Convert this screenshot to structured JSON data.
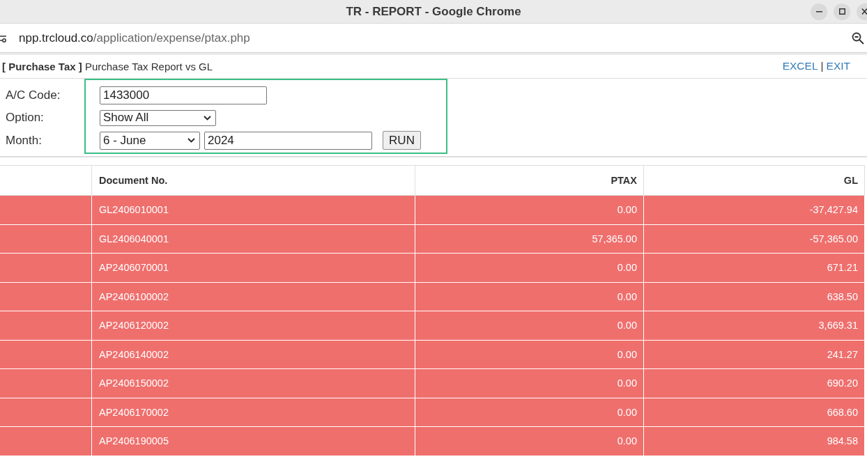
{
  "window": {
    "title": "TR - REPORT - Google Chrome"
  },
  "address_bar": {
    "host": "npp.trcloud.co",
    "path": "/application/expense/ptax.php"
  },
  "page_header": {
    "title": "**[ Purchase Tax ]** Purchase Tax Report vs GL",
    "links": [
      {
        "label": "EXCEL"
      },
      {
        "label": "EXIT"
      }
    ],
    "separator": "|"
  },
  "form": {
    "fields": [
      {
        "kind": "text",
        "label": "A/C Code:",
        "value": "1433000"
      },
      {
        "kind": "select",
        "label": "Option:",
        "value": "Show All"
      },
      {
        "kind": "month",
        "label": "Month:",
        "month": "6 - June",
        "year": "2024",
        "button": "RUN"
      }
    ]
  },
  "table": {
    "columns": [
      "Document No.",
      "PTAX",
      "GL"
    ],
    "rows": [
      {
        "flagged": true,
        "cells": [
          "GL2406010001",
          "0.00",
          "-37,427.94"
        ]
      },
      {
        "flagged": true,
        "cells": [
          "GL2406040001",
          "57,365.00",
          "-57,365.00"
        ]
      },
      {
        "flagged": true,
        "cells": [
          "AP2406070001",
          "0.00",
          "671.21"
        ]
      },
      {
        "flagged": true,
        "cells": [
          "AP2406100002",
          "0.00",
          "638.50"
        ]
      },
      {
        "flagged": true,
        "cells": [
          "AP2406120002",
          "0.00",
          "3,669.31"
        ]
      },
      {
        "flagged": true,
        "cells": [
          "AP2406140002",
          "0.00",
          "241.27"
        ]
      },
      {
        "flagged": true,
        "cells": [
          "AP2406150002",
          "0.00",
          "690.20"
        ]
      },
      {
        "flagged": true,
        "cells": [
          "AP2406170002",
          "0.00",
          "668.60"
        ]
      },
      {
        "flagged": true,
        "cells": [
          "AP2406190005",
          "0.00",
          "984.58"
        ]
      }
    ]
  }
}
